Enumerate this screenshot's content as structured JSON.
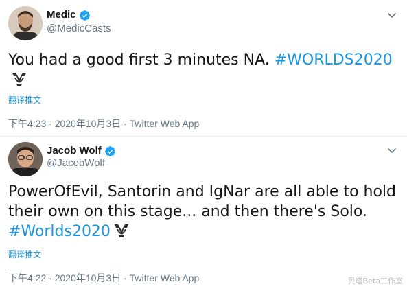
{
  "tweets": [
    {
      "display_name": "Medic",
      "handle": "@MedicCasts",
      "body_text": "You had a good first 3 minutes NA. ",
      "hashtag": "#WORLDS2020",
      "translate_label": "翻译推文",
      "time": "下午4:23 · 2020年10月3日",
      "separator": " · ",
      "source": "Twitter Web App",
      "verified": true
    },
    {
      "display_name": "Jacob Wolf",
      "handle": "@JacobWolf",
      "body_text": "PowerOfEvil, Santorin and IgNar are all able to hold their own on this stage... and then there's Solo. ",
      "hashtag": "#Worlds2020",
      "translate_label": "翻译推文",
      "time": "下午4:22 · 2020年10月3日",
      "separator": " · ",
      "source": "Twitter Web App",
      "verified": true
    }
  ],
  "watermark": "贝塔Beta工作室",
  "colors": {
    "link": "#1b95e0",
    "secondary_text": "#657786",
    "primary_text": "#14171a",
    "verified_badge": "#1da1f2"
  },
  "icons": {
    "verified": "verified-badge-icon",
    "caret": "chevron-down-icon",
    "hashflag": "worlds-trophy-hashflag-icon"
  }
}
